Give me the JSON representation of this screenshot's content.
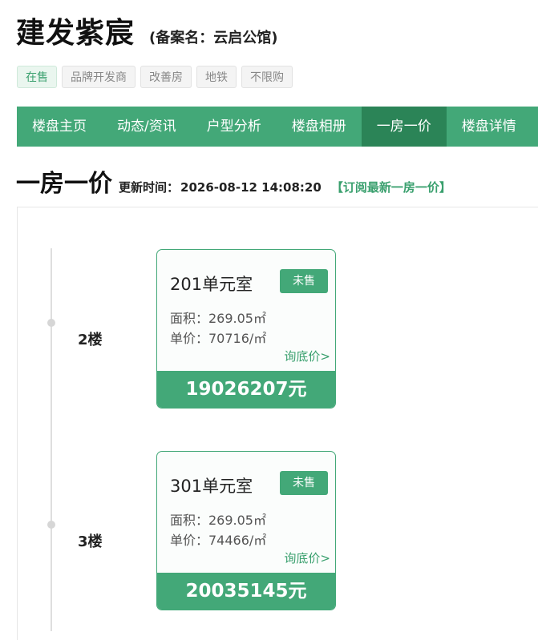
{
  "header": {
    "title": "建发紫宸",
    "registered_name": "(备案名：云启公馆)"
  },
  "tags": [
    "在售",
    "品牌开发商",
    "改善房",
    "地铁",
    "不限购"
  ],
  "nav": {
    "items": [
      "楼盘主页",
      "动态/资讯",
      "户型分析",
      "楼盘相册",
      "一房一价",
      "楼盘详情"
    ],
    "active": "一房一价"
  },
  "section": {
    "title": "一房一价",
    "update_label": "更新时间：",
    "update_time": "2026-08-12 14:08:20",
    "subscribe_link": "【订阅最新一房一价】"
  },
  "floors": [
    {
      "floor": "2楼",
      "unit": "201单元室",
      "status": "未售",
      "area": "面积：269.05㎡",
      "unit_price": "单价：70716/㎡",
      "inquiry": "询底价>",
      "total_price": "19026207元"
    },
    {
      "floor": "3楼",
      "unit": "301单元室",
      "status": "未售",
      "area": "面积：269.05㎡",
      "unit_price": "单价：74466/㎡",
      "inquiry": "询底价>",
      "total_price": "20035145元"
    }
  ],
  "colors": {
    "brand_green": "#43a878",
    "active_nav": "#2b8457"
  }
}
